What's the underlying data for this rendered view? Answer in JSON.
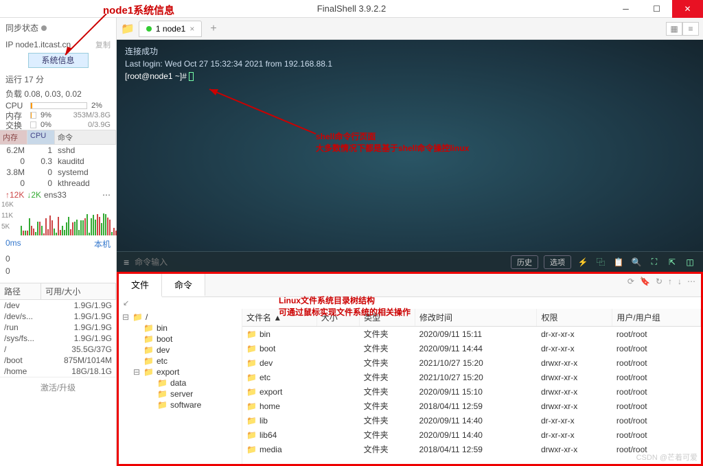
{
  "app": {
    "title": "FinalShell 3.9.2.2"
  },
  "annotations": {
    "sysinfo": "node1系统信息",
    "shell1": "shell命令行页面",
    "shell2": "大多数情况下都是基于shell命令操控linux",
    "fs1": "Linux文件系统目录树结构",
    "fs2": "可通过鼠标实现文件系统的相关操作"
  },
  "sidebar": {
    "sync_label": "同步状态",
    "ip": "IP node1.itcast.cn",
    "copy": "复制",
    "sysinfo_btn": "系统信息",
    "uptime": "运行 17 分",
    "load": "负载 0.08, 0.03, 0.02",
    "cpu": {
      "label": "CPU",
      "pct": "2%",
      "fill": 2
    },
    "mem": {
      "label": "内存",
      "pct": "9%",
      "val": "353M/3.8G",
      "fill": 9
    },
    "swap": {
      "label": "交换",
      "pct": "0%",
      "val": "0/3.9G",
      "fill": 0
    },
    "proc_headers": {
      "m": "内存",
      "c": "CPU",
      "cmd": "命令"
    },
    "procs": [
      {
        "m": "6.2M",
        "c": "1",
        "cmd": "sshd"
      },
      {
        "m": "0",
        "c": "0.3",
        "cmd": "kauditd"
      },
      {
        "m": "3.8M",
        "c": "0",
        "cmd": "systemd"
      },
      {
        "m": "0",
        "c": "0",
        "cmd": "kthreadd"
      }
    ],
    "net": {
      "up": "↑12K",
      "dn": "↓2K",
      "iface": "ens33",
      "more": "⋯"
    },
    "chart_y": [
      "16K",
      "11K",
      "5K"
    ],
    "latency": {
      "ms": "0ms",
      "host": "本机"
    },
    "latency_vals": [
      "0",
      "0"
    ],
    "path_head": {
      "p": "路径",
      "s": "可用/大小"
    },
    "paths": [
      {
        "p": "/dev",
        "s": "1.9G/1.9G"
      },
      {
        "p": "/dev/s...",
        "s": "1.9G/1.9G"
      },
      {
        "p": "/run",
        "s": "1.9G/1.9G"
      },
      {
        "p": "/sys/fs...",
        "s": "1.9G/1.9G"
      },
      {
        "p": "/",
        "s": "35.5G/37G"
      },
      {
        "p": "/boot",
        "s": "875M/1014M"
      },
      {
        "p": "/home",
        "s": "18G/18.1G"
      }
    ],
    "upgrade": "激活/升级"
  },
  "tabs": {
    "tab1": "1 node1"
  },
  "terminal": {
    "l1": "连接成功",
    "l2": "Last login: Wed Oct 27 15:32:34 2021 from 192.168.88.1",
    "prompt": "[root@node1 ~]#",
    "input_placeholder": "命令输入",
    "history": "历史",
    "options": "选项"
  },
  "filetabs": {
    "files": "文件",
    "cmd": "命令"
  },
  "tree": {
    "root": "/",
    "items": [
      "bin",
      "boot",
      "dev",
      "etc",
      "export"
    ],
    "export_children": [
      "data",
      "server",
      "software"
    ]
  },
  "filelist": {
    "headers": {
      "name": "文件名 ▲",
      "size": "大小",
      "type": "类型",
      "mtime": "修改时间",
      "perm": "权限",
      "owner": "用户/用户组"
    },
    "rows": [
      {
        "name": "bin",
        "type": "文件夹",
        "mtime": "2020/09/11 15:11",
        "perm": "dr-xr-xr-x",
        "owner": "root/root"
      },
      {
        "name": "boot",
        "type": "文件夹",
        "mtime": "2020/09/11 14:44",
        "perm": "dr-xr-xr-x",
        "owner": "root/root"
      },
      {
        "name": "dev",
        "type": "文件夹",
        "mtime": "2021/10/27 15:20",
        "perm": "drwxr-xr-x",
        "owner": "root/root"
      },
      {
        "name": "etc",
        "type": "文件夹",
        "mtime": "2021/10/27 15:20",
        "perm": "drwxr-xr-x",
        "owner": "root/root"
      },
      {
        "name": "export",
        "type": "文件夹",
        "mtime": "2020/09/11 15:10",
        "perm": "drwxr-xr-x",
        "owner": "root/root"
      },
      {
        "name": "home",
        "type": "文件夹",
        "mtime": "2018/04/11 12:59",
        "perm": "drwxr-xr-x",
        "owner": "root/root"
      },
      {
        "name": "lib",
        "type": "文件夹",
        "mtime": "2020/09/11 14:40",
        "perm": "dr-xr-xr-x",
        "owner": "root/root"
      },
      {
        "name": "lib64",
        "type": "文件夹",
        "mtime": "2020/09/11 14:40",
        "perm": "dr-xr-xr-x",
        "owner": "root/root"
      },
      {
        "name": "media",
        "type": "文件夹",
        "mtime": "2018/04/11 12:59",
        "perm": "drwxr-xr-x",
        "owner": "root/root"
      }
    ]
  },
  "watermark": "CSDN @芒着可爱"
}
